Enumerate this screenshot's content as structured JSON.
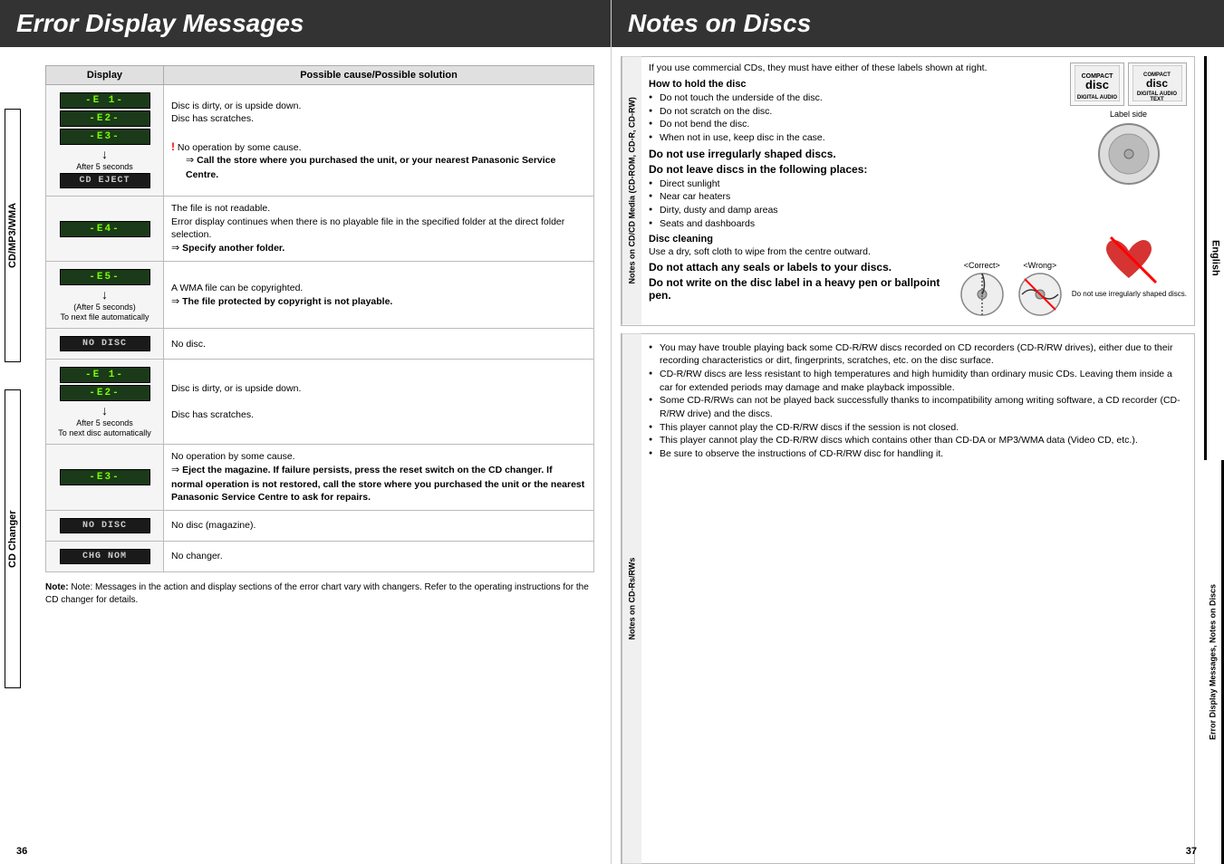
{
  "leftPage": {
    "title": "Error Display Messages",
    "pageNum": "36",
    "tableHeaders": {
      "display": "Display",
      "solution": "Possible cause/Possible solution"
    },
    "sideLabels": {
      "cdmp3": "CD/MP3/WMA",
      "cdChanger": "CD Changer"
    },
    "rows": [
      {
        "group": "cdmp3",
        "displays": [
          "-E 1-",
          "-E2-",
          "-E3-"
        ],
        "captions": [
          "After 5 seconds",
          "CD EJECT"
        ],
        "solution": [
          "Disc is dirty, or is upside down.",
          "Disc has scratches.",
          "! No operation by some cause.",
          "⇒ Call the store where you purchased the unit, or your nearest Panasonic Service Centre."
        ]
      },
      {
        "group": "cdmp3",
        "displays": [
          "-E4-"
        ],
        "solution": [
          "The file is not readable.",
          "Error display continues when there is no playable file in the specified folder at the direct folder selection.",
          "⇒ Specify another folder."
        ]
      },
      {
        "group": "cdmp3",
        "displays": [
          "-E5-"
        ],
        "captions": [
          "(After 5 seconds)",
          "To next file automatically"
        ],
        "solution": [
          "A WMA file can be copyrighted.",
          "⇒ The file protected by copyright is not playable."
        ]
      },
      {
        "group": "cdmp3",
        "displays": [
          "NO DISC"
        ],
        "solution": [
          "No disc."
        ]
      },
      {
        "group": "cdchanger",
        "displays": [
          "-E 1-",
          "-E2-"
        ],
        "captions": [
          "After 5 seconds",
          "To next disc automatically"
        ],
        "solution": [
          "Disc is dirty, or is upside down.",
          "Disc has scratches."
        ]
      },
      {
        "group": "cdchanger",
        "displays": [
          "-E3-"
        ],
        "solution": [
          "No operation by some cause.",
          "⇒ Eject the magazine. If failure persists, press the reset switch on the CD changer.  If normal operation is not restored, call the store where you purchased the unit or the nearest Panasonic Service Centre to ask for repairs."
        ]
      },
      {
        "group": "cdchanger",
        "displays": [
          "NO DISC"
        ],
        "solution": [
          "No disc (magazine)."
        ]
      },
      {
        "group": "cdchanger",
        "displays": [
          "CHG NOM"
        ],
        "solution": [
          "No changer."
        ]
      }
    ],
    "note": "Note: Messages in the action and display sections of the error chart vary with changers. Refer to the operating instructions for the CD changer for details."
  },
  "rightPage": {
    "title": "Notes on Discs",
    "pageNum": "37",
    "sideLabels": {
      "english": "English",
      "errorMessages": "Error Display Messages, Notes on Discs"
    },
    "cdMediaSection": {
      "label": "Notes on CD/CD Media (CD-ROM, CD-R, CD-RW)",
      "commercialCDs": "If you use commercial CDs, they must have either of these labels shown at right.",
      "labelSide": "Label side",
      "holdDisc": {
        "title": "How to hold the disc",
        "items": [
          "Do not touch the underside of the disc.",
          "Do not scratch on the disc.",
          "Do not bend the disc.",
          "When not in use, keep disc in the case."
        ]
      },
      "irregularDiscs": "Do not use irregularly shaped discs.",
      "irregularLabel": "Do not use irregularly shaped discs.",
      "leaveDiscs": {
        "title": "Do not leave discs in the following places:",
        "items": [
          "Direct sunlight",
          "Near car heaters",
          "Dirty, dusty and damp areas",
          "Seats and dashboards"
        ]
      },
      "discCleaning": {
        "title": "Disc cleaning",
        "text": "Use a dry, soft cloth to wipe from the centre outward."
      },
      "noSeals": "Do not attach any seals or labels to your discs.",
      "noBallpoint": "Do not write on the disc label in a heavy pen or ballpoint pen.",
      "correct": "<Correct>",
      "wrong": "<Wrong>"
    },
    "cdrSection": {
      "label": "Notes on CD-Rs/RWs",
      "items": [
        "You may have trouble playing back some CD-R/RW discs recorded on CD recorders (CD-R/RW drives), either due to their recording characteristics or dirt, fingerprints, scratches, etc. on the disc surface.",
        "CD-R/RW discs are less resistant to high temperatures and high humidity than ordinary music CDs. Leaving them inside a car for extended periods may damage and make playback impossible.",
        "Some CD-R/RWs can not be played back successfully thanks to incompatibility among writing software, a CD recorder (CD-R/RW drive) and the discs.",
        "This player cannot play the CD-R/RW discs if the session is not closed.",
        "This player cannot play the CD-R/RW discs which contains other than CD-DA or MP3/WMA data (Video CD, etc.).",
        "Be sure to observe the instructions of CD-R/RW disc for handling it."
      ]
    }
  }
}
